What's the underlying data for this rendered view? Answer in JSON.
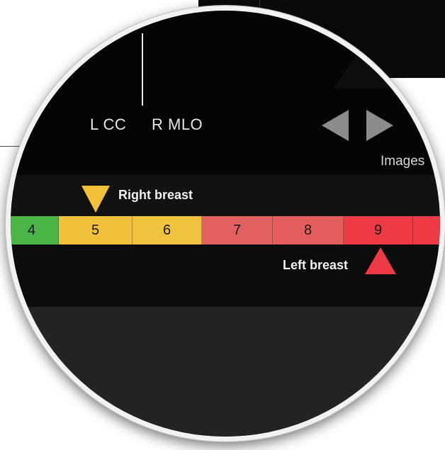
{
  "viewer": {
    "views": [
      "L CC",
      "R MLO"
    ],
    "nav": {
      "prev_icon": "triangle-left-icon",
      "next_icon": "triangle-right-icon"
    },
    "images_label": "Images"
  },
  "density_scale": {
    "cells": [
      {
        "label": "4",
        "color": "#4cb548"
      },
      {
        "label": "5",
        "color": "#f1c13c"
      },
      {
        "label": "6",
        "color": "#efc33d"
      },
      {
        "label": "7",
        "color": "#e2605f"
      },
      {
        "label": "8",
        "color": "#e35e5c"
      },
      {
        "label": "9",
        "color": "#ee3a44"
      },
      {
        "label": "",
        "color": "#ee3a44"
      }
    ],
    "markers": {
      "right_breast": {
        "label": "Right breast",
        "value": 5,
        "color": "#f2c13a",
        "icon": "triangle-down-icon"
      },
      "left_breast": {
        "label": "Left breast",
        "value": 9,
        "color": "#ee3a44",
        "icon": "triangle-up-icon"
      }
    }
  }
}
